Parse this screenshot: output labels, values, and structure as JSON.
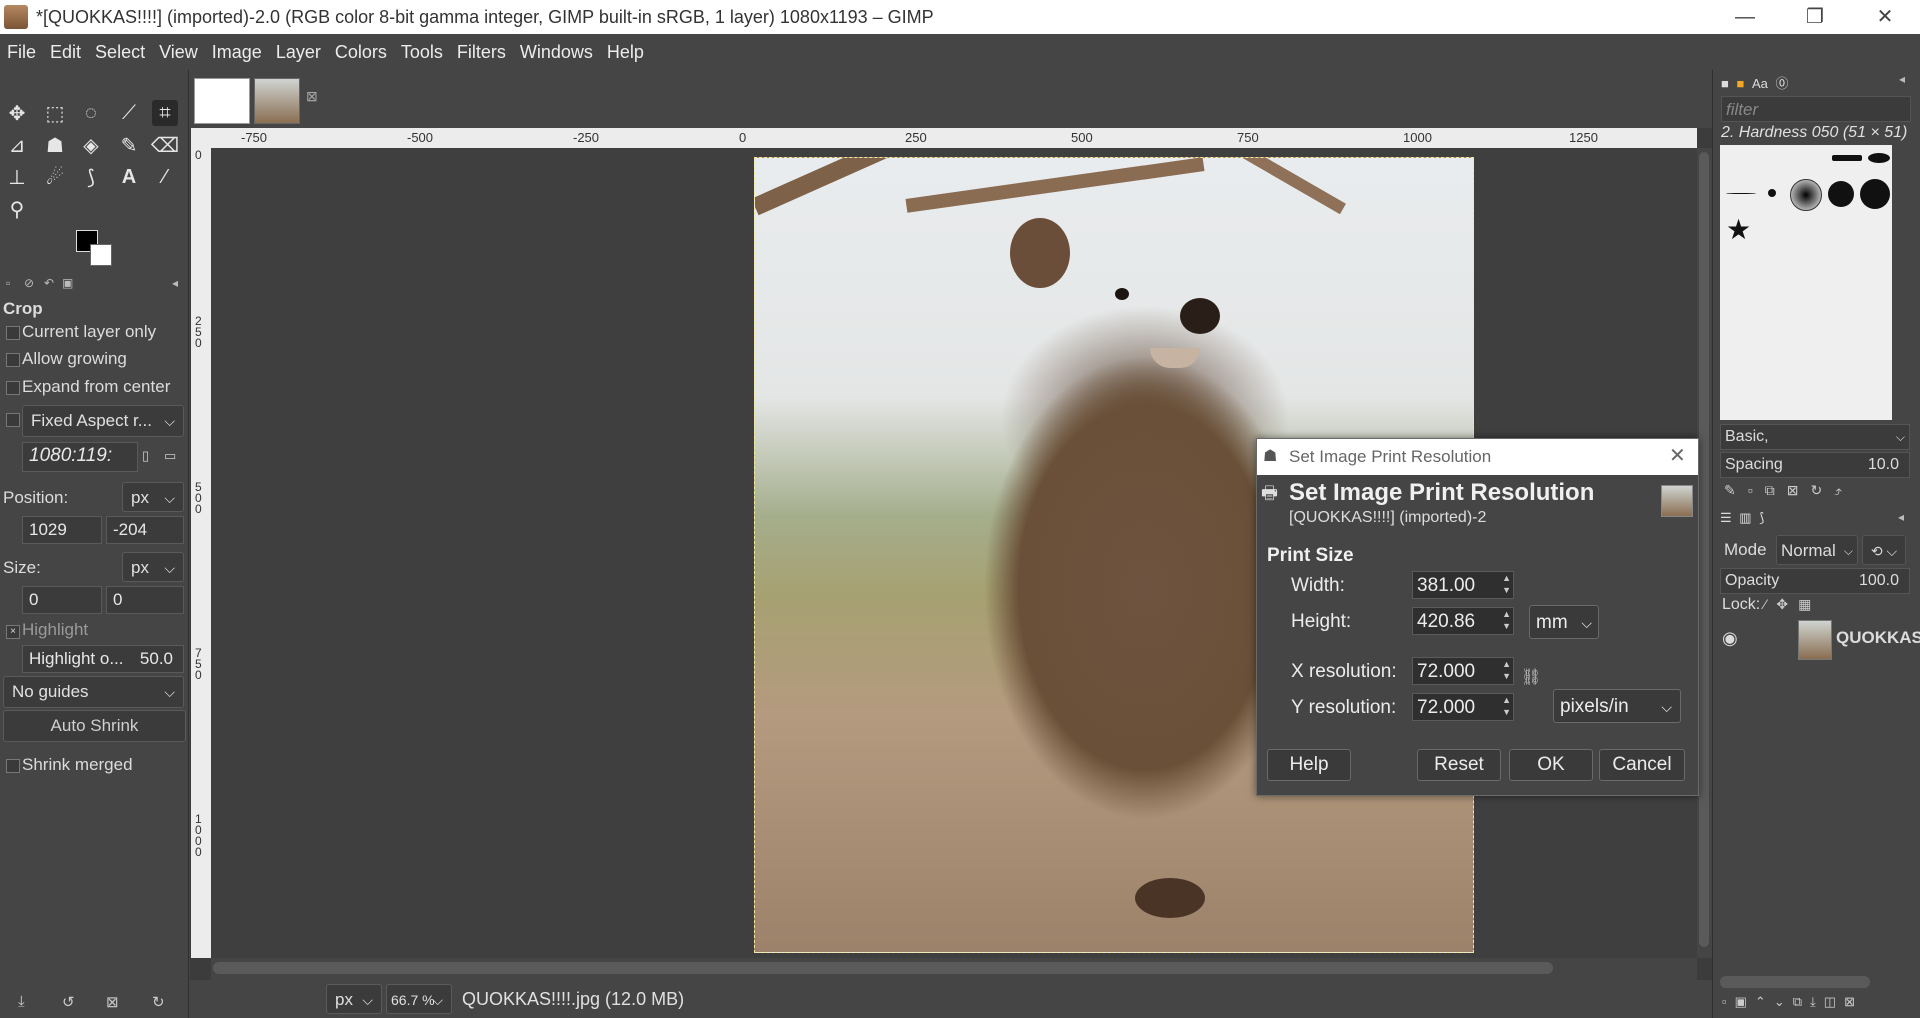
{
  "window": {
    "title": "*[QUOKKAS!!!!] (imported)-2.0 (RGB color 8-bit gamma integer, GIMP built-in sRGB, 1 layer) 1080x1193 – GIMP",
    "minimize": "—",
    "restore": "❐",
    "close": "✕"
  },
  "menubar": [
    "File",
    "Edit",
    "Select",
    "View",
    "Image",
    "Layer",
    "Colors",
    "Tools",
    "Filters",
    "Windows",
    "Help"
  ],
  "tool_options": {
    "title": "Crop",
    "current_layer_only": "Current layer only",
    "allow_growing": "Allow growing",
    "expand_from_center": "Expand from center",
    "fixed_aspect": "Fixed Aspect r...",
    "aspect_value": "1080:119:",
    "position_label": "Position:",
    "position_unit": "px",
    "position_x": "1029",
    "position_y": "-204",
    "size_label": "Size:",
    "size_unit": "px",
    "size_w": "0",
    "size_h": "0",
    "highlight": "Highlight",
    "highlight_opacity_label": "Highlight o...",
    "highlight_opacity_value": "50.0",
    "guides": "No guides",
    "auto_shrink": "Auto Shrink",
    "shrink_merged": "Shrink merged"
  },
  "ruler": {
    "h_ticks": [
      "-750",
      "-500",
      "-250",
      "0",
      "250",
      "500",
      "750",
      "1000",
      "1250"
    ],
    "v_ticks": [
      "0",
      "250",
      "500",
      "750",
      "1000"
    ]
  },
  "statusbar": {
    "unit": "px",
    "zoom": "66.7 %",
    "file_info": "QUOKKAS!!!!.jpg (12.0 MB)"
  },
  "dock": {
    "filter_placeholder": "filter",
    "brush_name": "2. Hardness 050 (51 × 51)",
    "brush_set": "Basic,",
    "spacing_label": "Spacing",
    "spacing_value": "10.0",
    "mode_label": "Mode",
    "mode_value": "Normal",
    "opacity_label": "Opacity",
    "opacity_value": "100.0",
    "lock_label": "Lock:",
    "layer_name": "QUOKKAS"
  },
  "dialog": {
    "window_title": "Set Image Print Resolution",
    "heading": "Set Image Print Resolution",
    "subheading": "[QUOKKAS!!!!] (imported)-2",
    "section": "Print Size",
    "width_label": "Width:",
    "width_value": "381.00",
    "height_label": "Height:",
    "height_value": "420.86",
    "size_unit": "mm",
    "xres_label": "X resolution:",
    "xres_value": "72.000",
    "yres_label": "Y resolution:",
    "yres_value": "72.000",
    "res_unit": "pixels/in",
    "help": "Help",
    "reset": "Reset",
    "ok": "OK",
    "cancel": "Cancel"
  }
}
